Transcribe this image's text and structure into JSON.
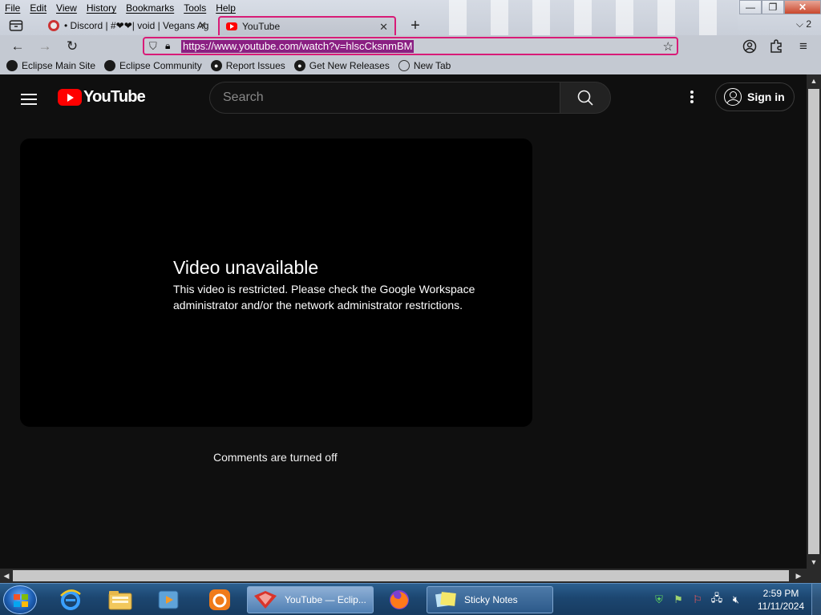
{
  "menubar": [
    "File",
    "Edit",
    "View",
    "History",
    "Bookmarks",
    "Tools",
    "Help"
  ],
  "window_controls": {
    "minimize": "—",
    "restore": "❐",
    "close": "✕"
  },
  "tabs": [
    {
      "label": "• Discord | #❤❤| void | Vegans Ag",
      "active": false
    },
    {
      "label": "YouTube",
      "active": true
    }
  ],
  "tab_count": "2",
  "url": "https://www.youtube.com/watch?v=hlscCksnmBM",
  "bookmarks": [
    {
      "label": "Eclipse Main Site",
      "icon": "eclipse-icon"
    },
    {
      "label": "Eclipse Community",
      "icon": "eclipse-icon"
    },
    {
      "label": "Report Issues",
      "icon": "github-icon"
    },
    {
      "label": "Get New Releases",
      "icon": "github-icon"
    },
    {
      "label": "New Tab",
      "icon": "globe-icon"
    }
  ],
  "youtube": {
    "logo_text": "YouTube",
    "search_placeholder": "Search",
    "signin_label": "Sign in",
    "error_title": "Video unavailable",
    "error_message": "This video is restricted. Please check the Google Workspace administrator and/or the network administrator restrictions.",
    "comments_status": "Comments are turned off"
  },
  "taskbar": {
    "apps": [
      {
        "label": "YouTube — Eclip...",
        "active": true
      },
      {
        "label": "Sticky Notes",
        "active": false
      }
    ],
    "clock_time": "2:59 PM",
    "clock_date": "11/11/2024"
  },
  "colors": {
    "accent_border": "#d81b77",
    "url_highlight": "#8a1f82",
    "youtube_red": "#ff0000",
    "page_bg": "#0f0f0f"
  }
}
